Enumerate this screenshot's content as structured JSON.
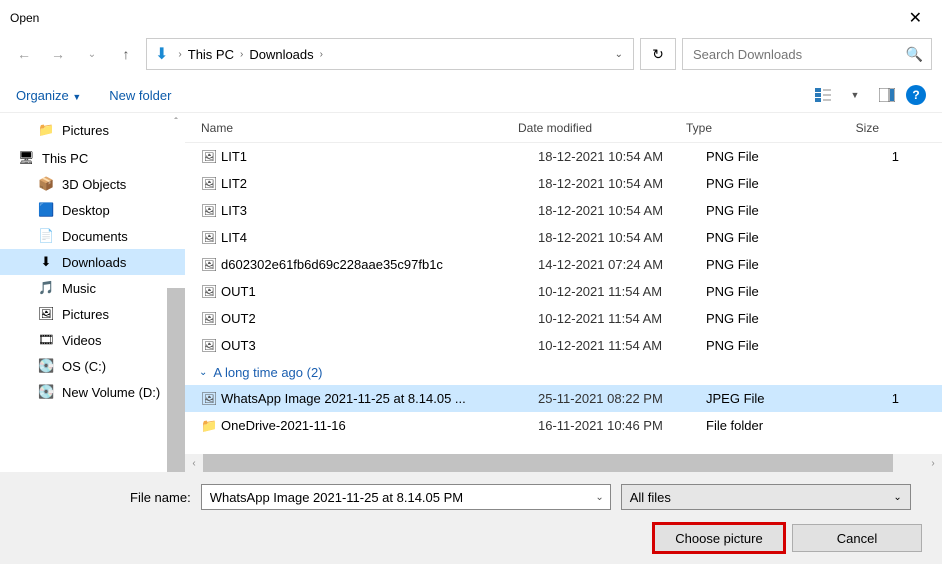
{
  "window": {
    "title": "Open"
  },
  "breadcrumb": {
    "root": "This PC",
    "folder": "Downloads"
  },
  "search": {
    "placeholder": "Search Downloads"
  },
  "toolbar": {
    "organize": "Organize",
    "newfolder": "New folder"
  },
  "sidebar": {
    "items": [
      {
        "label": "Pictures",
        "icon": "📁",
        "indent": true
      },
      {
        "label": "This PC",
        "icon": "🖥",
        "root": true
      },
      {
        "label": "3D Objects",
        "icon": "📦",
        "indent": true
      },
      {
        "label": "Desktop",
        "icon": "🟦",
        "indent": true
      },
      {
        "label": "Documents",
        "icon": "📄",
        "indent": true
      },
      {
        "label": "Downloads",
        "icon": "⬇",
        "indent": true,
        "selected": true
      },
      {
        "label": "Music",
        "icon": "🎵",
        "indent": true
      },
      {
        "label": "Pictures",
        "icon": "🖼",
        "indent": true
      },
      {
        "label": "Videos",
        "icon": "🎞",
        "indent": true
      },
      {
        "label": "OS (C:)",
        "icon": "💽",
        "indent": true
      },
      {
        "label": "New Volume (D:)",
        "icon": "💽",
        "indent": true
      }
    ]
  },
  "columns": {
    "name": "Name",
    "date": "Date modified",
    "type": "Type",
    "size": "Size"
  },
  "files": [
    {
      "name": "LIT1",
      "date": "18-12-2021 10:54 AM",
      "type": "PNG File",
      "size": "1",
      "icon": "🖼"
    },
    {
      "name": "LIT2",
      "date": "18-12-2021 10:54 AM",
      "type": "PNG File",
      "size": "",
      "icon": "🖼"
    },
    {
      "name": "LIT3",
      "date": "18-12-2021 10:54 AM",
      "type": "PNG File",
      "size": "",
      "icon": "🖼"
    },
    {
      "name": "LIT4",
      "date": "18-12-2021 10:54 AM",
      "type": "PNG File",
      "size": "",
      "icon": "🖼"
    },
    {
      "name": "d602302e61fb6d69c228aae35c97fb1c",
      "date": "14-12-2021 07:24 AM",
      "type": "PNG File",
      "size": "",
      "icon": "🖼"
    },
    {
      "name": "OUT1",
      "date": "10-12-2021 11:54 AM",
      "type": "PNG File",
      "size": "",
      "icon": "🖼"
    },
    {
      "name": "OUT2",
      "date": "10-12-2021 11:54 AM",
      "type": "PNG File",
      "size": "",
      "icon": "🖼"
    },
    {
      "name": "OUT3",
      "date": "10-12-2021 11:54 AM",
      "type": "PNG File",
      "size": "",
      "icon": "🖼"
    }
  ],
  "group": {
    "label": "A long time ago (2)"
  },
  "files2": [
    {
      "name": "WhatsApp Image 2021-11-25 at 8.14.05 ...",
      "date": "25-11-2021 08:22 PM",
      "type": "JPEG File",
      "size": "1",
      "icon": "🖼",
      "selected": true
    },
    {
      "name": "OneDrive-2021-11-16",
      "date": "16-11-2021 10:46 PM",
      "type": "File folder",
      "size": "",
      "icon": "📁"
    }
  ],
  "footer": {
    "fn_label": "File name:",
    "fn_value": "WhatsApp Image 2021-11-25 at 8.14.05 PM",
    "filter": "All files",
    "choose": "Choose picture",
    "cancel": "Cancel"
  }
}
